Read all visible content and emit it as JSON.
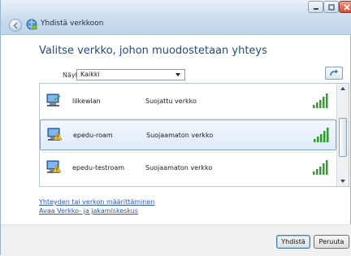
{
  "window": {
    "title": "Yhdistä verkkoon"
  },
  "heading": "Valitse verkko, johon muodostetaan yhteys",
  "filter": {
    "label": "Näytä",
    "value": "Kaikki"
  },
  "networks": [
    {
      "name": "liikewlan",
      "security": "Suojattu verkko",
      "icon": "wireless-network-icon",
      "signal": 5,
      "selected": false
    },
    {
      "name": "epedu-roam",
      "security": "Suojaamaton verkko",
      "icon": "unsecured-network-icon",
      "signal": 5,
      "selected": true
    },
    {
      "name": "epedu-testroam",
      "security": "Suojaamaton verkko",
      "icon": "unsecured-network-icon",
      "signal": 5,
      "selected": false
    }
  ],
  "links": {
    "setup": "Yhteyden tai verkon määrittäminen",
    "center": "Avaa Verkko- ja jakamiskeskus"
  },
  "buttons": {
    "connect": "Yhdistä",
    "cancel": "Peruuta"
  },
  "colors": {
    "heading": "#1f4a82",
    "link": "#2a57b5",
    "signal": "#2e9e2e",
    "selection": "#dfebf9"
  }
}
